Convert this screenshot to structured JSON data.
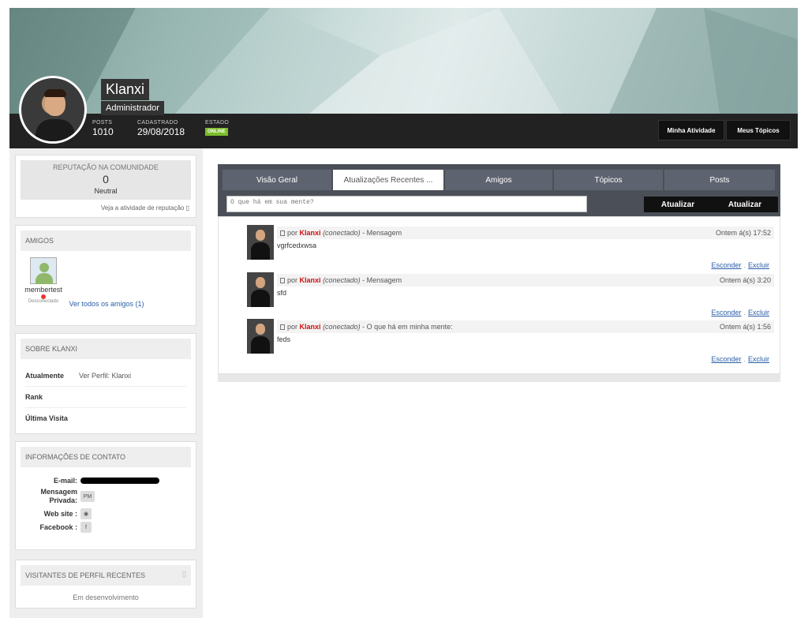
{
  "profile": {
    "name": "Klanxi",
    "role": "Administrador",
    "stats": [
      {
        "label": "POSTS",
        "value": "1010"
      },
      {
        "label": "CADASTRADO",
        "value": "29/08/2018"
      },
      {
        "label": "ESTADO",
        "value": "ONLINE"
      }
    ],
    "buttons": {
      "activity": "Minha Atividade",
      "topics": "Meus Tópicos"
    }
  },
  "reputation": {
    "title": "REPUTAÇÃO NA COMUNIDADE",
    "value": "0",
    "level": "Neutral",
    "link": "Veja a atividade de reputação"
  },
  "friends": {
    "title": "AMIGOS",
    "items": [
      {
        "name": "membertest",
        "status": "Desconectado"
      }
    ],
    "see_all": "Ver todos os amigos (1)"
  },
  "about": {
    "title": "SOBRE KLANXI",
    "rows": [
      {
        "label": "Atualmente",
        "value": "Ver Perfil: Klanxi"
      },
      {
        "label": "Rank",
        "value": ""
      },
      {
        "label": "Última Visita",
        "value": ""
      }
    ]
  },
  "contact": {
    "title": "INFORMAÇÕES DE CONTATO",
    "email_label": "E-mail:",
    "pm_label_1": "Mensagem",
    "pm_label_2": "Privada:",
    "pm_icon": "PM",
    "website_label": "Web site :",
    "facebook_label": "Facebook :",
    "facebook_icon": "f"
  },
  "visitors": {
    "title": "VISITANTES DE PERFIL RECENTES",
    "text": "Em desenvolvimento"
  },
  "tabs": [
    {
      "label": "Visão Geral"
    },
    {
      "label": "Atualizações Recentes ..."
    },
    {
      "label": "Amigos"
    },
    {
      "label": "Tópicos"
    },
    {
      "label": "Posts"
    }
  ],
  "composer": {
    "placeholder": "O que há em sua mente?",
    "button1": "Atualizar",
    "button2": "Atualizar"
  },
  "feed": [
    {
      "by": "por",
      "user": "Klanxi",
      "state": "(conectado)",
      "kind": "- Mensagem",
      "time": "Ontem á(s) 17:52",
      "body": "vgrfcedxwsa"
    },
    {
      "by": "por",
      "user": "Klanxi",
      "state": "(conectado)",
      "kind": "- Mensagem",
      "time": "Ontem á(s) 3:20",
      "body": "sfd"
    },
    {
      "by": "por",
      "user": "Klanxi",
      "state": "(conectado)",
      "kind": "- O que há em minha mente:",
      "time": "Ontem á(s) 1:56",
      "body": "feds"
    }
  ],
  "actions": {
    "hide": "Esconder",
    "sep": ".",
    "delete": "Excluir"
  }
}
